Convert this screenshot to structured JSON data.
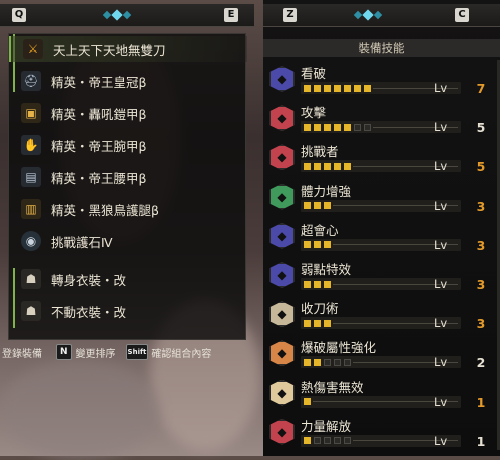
{
  "colors": {
    "pip_on": "#e6b62a",
    "level_max": "#e39a2b",
    "level_normal": "#e5e0d2",
    "select_green": "#7fb44b",
    "tab_dot": "#2e8ea4",
    "tab_dot_active": "#6fd8ee"
  },
  "left_panel": {
    "key_left": "Q",
    "key_right": "E",
    "items": [
      {
        "name": "天上天下天地無雙刀",
        "icon": "longsword-icon",
        "color": "#e8a020"
      },
      {
        "name": "精英・帝王皇冠β",
        "icon": "helm-icon",
        "color": "#b9c6d6"
      },
      {
        "name": "精英・轟吼鎧甲β",
        "icon": "chest-armor-icon",
        "color": "#e5b34a"
      },
      {
        "name": "精英・帝王腕甲β",
        "icon": "arm-armor-icon",
        "color": "#b9c6d6"
      },
      {
        "name": "精英・帝王腰甲β",
        "icon": "waist-armor-icon",
        "color": "#b9c6d6"
      },
      {
        "name": "精英・黑狼鳥護腿β",
        "icon": "leg-armor-icon",
        "color": "#e5b34a"
      },
      {
        "name": "挑戰護石Ⅳ",
        "icon": "charm-icon",
        "color": "#c9d4df"
      },
      {
        "name": "轉身衣裝・改",
        "icon": "mantle-icon",
        "color": "#d8d0bf"
      },
      {
        "name": "不動衣裝・改",
        "icon": "mantle-icon",
        "color": "#d8d0bf"
      }
    ],
    "bottom": {
      "register": "登錄裝備",
      "n_key": "N",
      "sort": "變更排序",
      "shift_key": "Shift",
      "confirm": "確認組合內容"
    }
  },
  "right_panel": {
    "key_left": "Z",
    "key_right": "C",
    "header": "裝備技能",
    "level_prefix": "Lv",
    "skills": [
      {
        "name": "看破",
        "icon_color": "#4b4aa8",
        "level": 7,
        "max": 7
      },
      {
        "name": "攻擊",
        "icon_color": "#c2434d",
        "level": 5,
        "max": 7
      },
      {
        "name": "挑戰者",
        "icon_color": "#c2434d",
        "level": 5,
        "max": 5
      },
      {
        "name": "體力增強",
        "icon_color": "#3f9a5c",
        "level": 3,
        "max": 3
      },
      {
        "name": "超會心",
        "icon_color": "#4b4aa8",
        "level": 3,
        "max": 3
      },
      {
        "name": "弱點特效",
        "icon_color": "#4b4aa8",
        "level": 3,
        "max": 3
      },
      {
        "name": "收刀術",
        "icon_color": "#c8b89a",
        "level": 3,
        "max": 3
      },
      {
        "name": "爆破屬性強化",
        "icon_color": "#d88548",
        "level": 2,
        "max": 5
      },
      {
        "name": "熱傷害無效",
        "icon_color": "#e0ca9c",
        "level": 1,
        "max": 1
      },
      {
        "name": "力量解放",
        "icon_color": "#c2434d",
        "level": 1,
        "max": 5
      }
    ]
  }
}
